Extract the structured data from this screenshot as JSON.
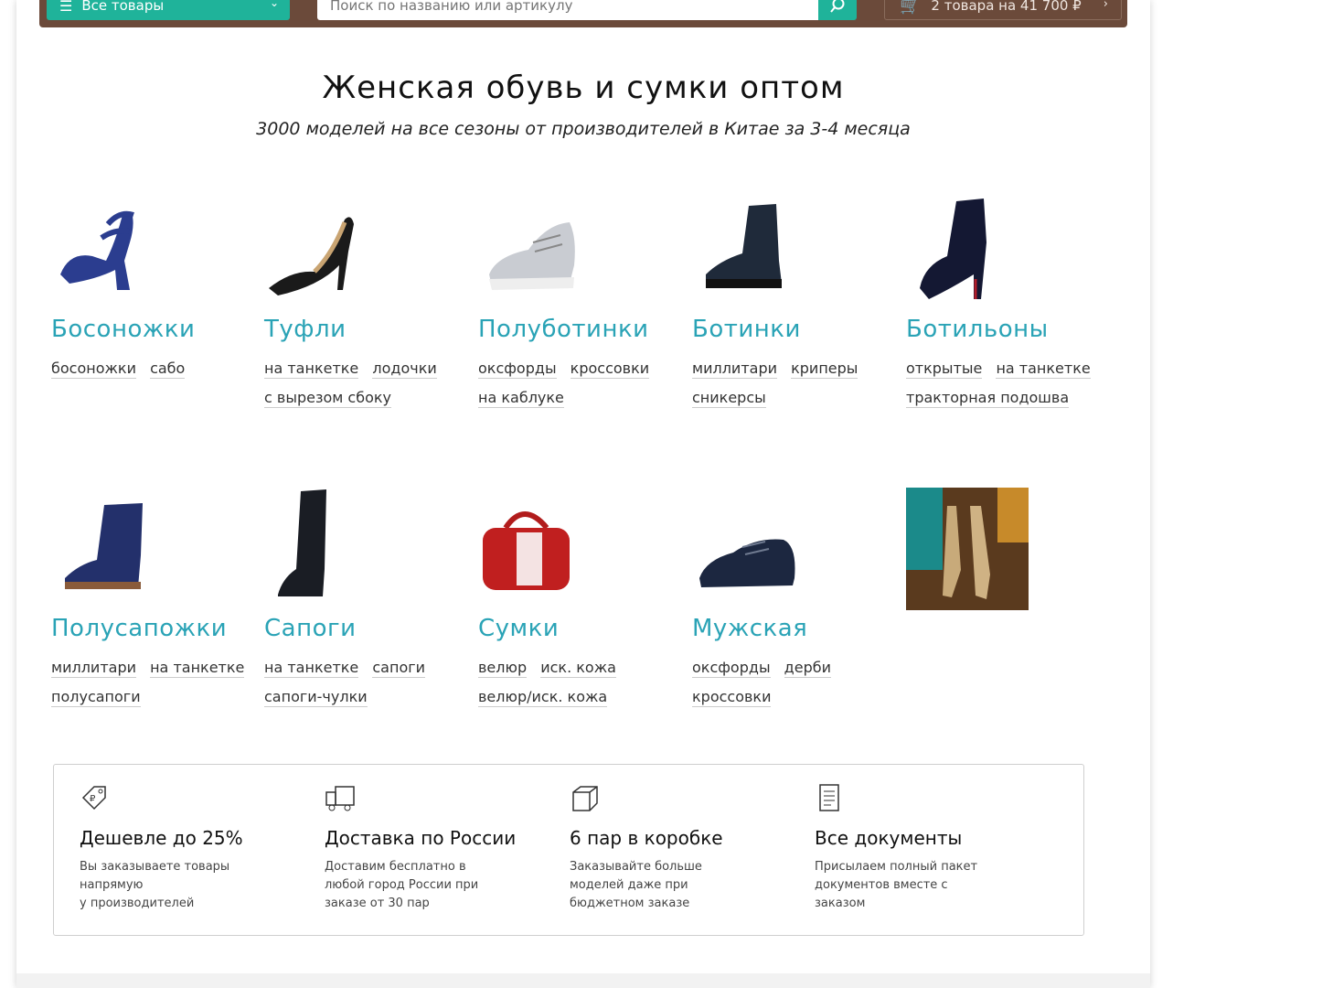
{
  "header": {
    "all_goods": "Все товары",
    "search_placeholder": "Поиск по названию или артикулу",
    "cart": "2 товара на 41 700 ₽"
  },
  "hero": {
    "title": "Женская обувь и сумки оптом",
    "subtitle": "3000 моделей на все сезоны от производителей в Китае за 3-4 месяца"
  },
  "categories": [
    {
      "name": "Босоножки",
      "icon": "sandal-image",
      "tags": [
        "босоножки",
        "сабо"
      ]
    },
    {
      "name": "Туфли",
      "icon": "pump-image",
      "tags": [
        "на танкетке",
        "лодочки",
        "с вырезом сбоку"
      ]
    },
    {
      "name": "Полуботинки",
      "icon": "sneaker-image",
      "tags": [
        "оксфорды",
        "кроссовки",
        "на каблуке"
      ]
    },
    {
      "name": "Ботинки",
      "icon": "boot-image",
      "tags": [
        "миллитари",
        "криперы",
        "сникерсы"
      ]
    },
    {
      "name": "Ботильоны",
      "icon": "ankle-boot-image",
      "tags": [
        "открытые",
        "на танкетке",
        "тракторная подошва"
      ]
    },
    {
      "name": "Полусапожки",
      "icon": "half-boot-image",
      "tags": [
        "миллитари",
        "на танкетке",
        "полусапоги"
      ]
    },
    {
      "name": "Сапоги",
      "icon": "tall-boot-image",
      "tags": [
        "на танкетке",
        "сапоги",
        "сапоги-чулки"
      ]
    },
    {
      "name": "Сумки",
      "icon": "handbag-image",
      "tags": [
        "велюр",
        "иск. кожа",
        "велюр/иск. кожа"
      ]
    },
    {
      "name": "Мужская",
      "icon": "mens-shoe-image",
      "tags": [
        "оксфорды",
        "дерби",
        "кроссовки"
      ]
    }
  ],
  "features": [
    {
      "title": "Дешевле до 25%",
      "icon": "price-tag-icon",
      "lines": [
        "Вы заказываете товары",
        "напрямую",
        "у производителей"
      ]
    },
    {
      "title": "Доставка по России",
      "icon": "truck-icon",
      "lines": [
        "Доставим бесплатно в",
        "любой город России при",
        "заказе от 30 пар"
      ]
    },
    {
      "title": "6 пар в коробке",
      "icon": "box-icon",
      "lines": [
        "Заказывайте больше",
        "моделей даже при",
        "бюджетном заказе"
      ]
    },
    {
      "title": "Все документы",
      "icon": "document-icon",
      "lines": [
        "Присылаем полный пакет",
        "документов вместе с",
        "заказом"
      ]
    }
  ],
  "colors": {
    "accent": "#1fb39a",
    "brand_bar": "#6b4a3a",
    "link": "#2aa3b6"
  }
}
